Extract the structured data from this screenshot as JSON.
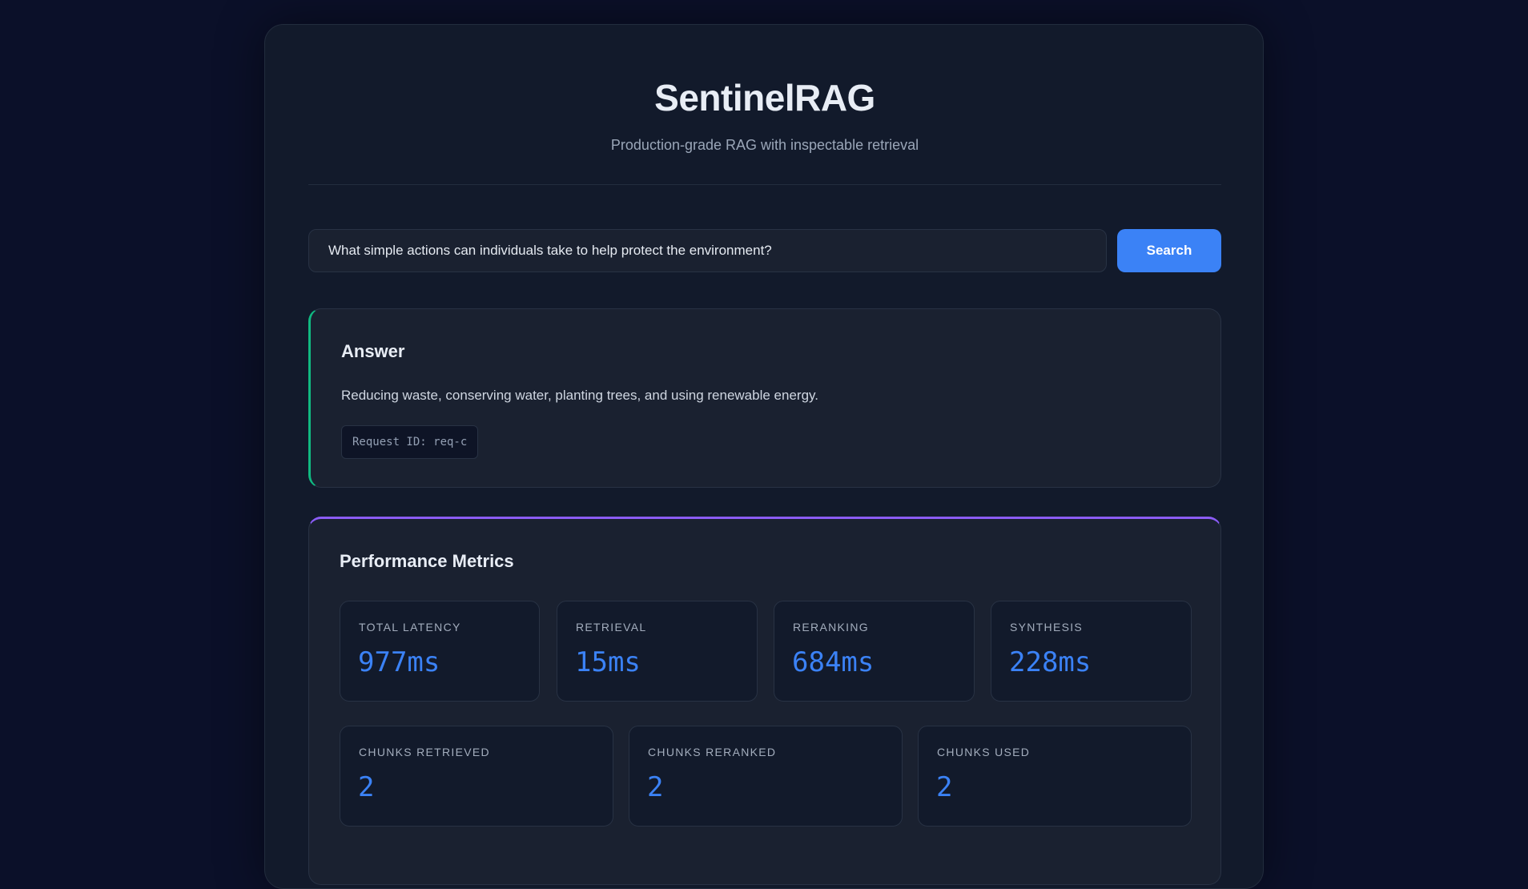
{
  "header": {
    "title": "SentinelRAG",
    "subtitle": "Production-grade RAG with inspectable retrieval"
  },
  "search": {
    "value": "What simple actions can individuals take to help protect the environment?",
    "button_label": "Search"
  },
  "answer": {
    "title": "Answer",
    "text": "Reducing waste, conserving water, planting trees, and using renewable energy.",
    "request_id": "Request ID: req-c"
  },
  "metrics": {
    "title": "Performance Metrics",
    "total_latency": {
      "label": "TOTAL LATENCY",
      "value": "977ms"
    },
    "retrieval": {
      "label": "RETRIEVAL",
      "value": "15ms"
    },
    "reranking": {
      "label": "RERANKING",
      "value": "684ms"
    },
    "synthesis": {
      "label": "SYNTHESIS",
      "value": "228ms"
    },
    "chunks_retrieved": {
      "label": "CHUNKS RETRIEVED",
      "value": "2"
    },
    "chunks_reranked": {
      "label": "CHUNKS RERANKED",
      "value": "2"
    },
    "chunks_used": {
      "label": "CHUNKS USED",
      "value": "2"
    }
  },
  "colors": {
    "accent": "#3b82f6",
    "answer_border": "#10b981",
    "metrics_border": "#8b5cf6",
    "background": "#0b1029"
  }
}
